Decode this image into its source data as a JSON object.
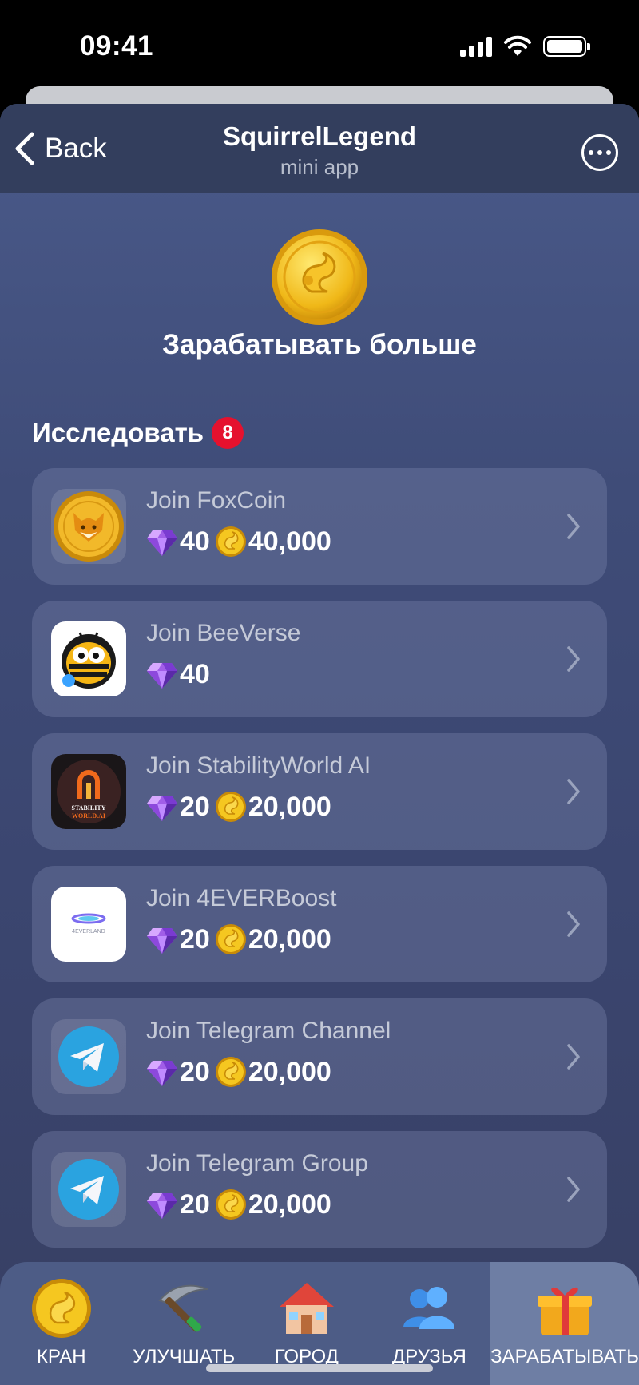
{
  "status_bar": {
    "time": "09:41"
  },
  "header": {
    "back_label": "Back",
    "title": "SquirrelLegend",
    "subtitle": "mini app"
  },
  "hero": {
    "title": "Зарабатывать больше"
  },
  "section": {
    "title": "Исследовать",
    "badge_count": "8"
  },
  "tasks": [
    {
      "title": "Join FoxCoin",
      "icon": "foxcoin-icon",
      "gems": "40",
      "coins": "40,000"
    },
    {
      "title": "Join BeeVerse",
      "icon": "beeverse-icon",
      "gems": "40",
      "coins": null
    },
    {
      "title": "Join StabilityWorld AI",
      "icon": "stabilityworld-icon",
      "gems": "20",
      "coins": "20,000"
    },
    {
      "title": "Join 4EVERBoost",
      "icon": "4everland-icon",
      "gems": "20",
      "coins": "20,000"
    },
    {
      "title": "Join Telegram Channel",
      "icon": "telegram-icon",
      "gems": "20",
      "coins": "20,000"
    },
    {
      "title": "Join Telegram Group",
      "icon": "telegram-icon",
      "gems": "20",
      "coins": "20,000"
    }
  ],
  "nav": [
    {
      "label": "КРАН",
      "icon": "squirrel-coin-icon"
    },
    {
      "label": "УЛУЧШАТЬ",
      "icon": "pickaxe-icon"
    },
    {
      "label": "ГОРОД",
      "icon": "house-icon"
    },
    {
      "label": "ДРУЗЬЯ",
      "icon": "friends-icon"
    },
    {
      "label": "ЗАРАБАТЫВАТЬ",
      "icon": "gift-icon",
      "active": true
    }
  ],
  "colors": {
    "badge": "#e5112e",
    "coin_gold": "#f2c21a",
    "gem_purple": "#9b5de5"
  }
}
